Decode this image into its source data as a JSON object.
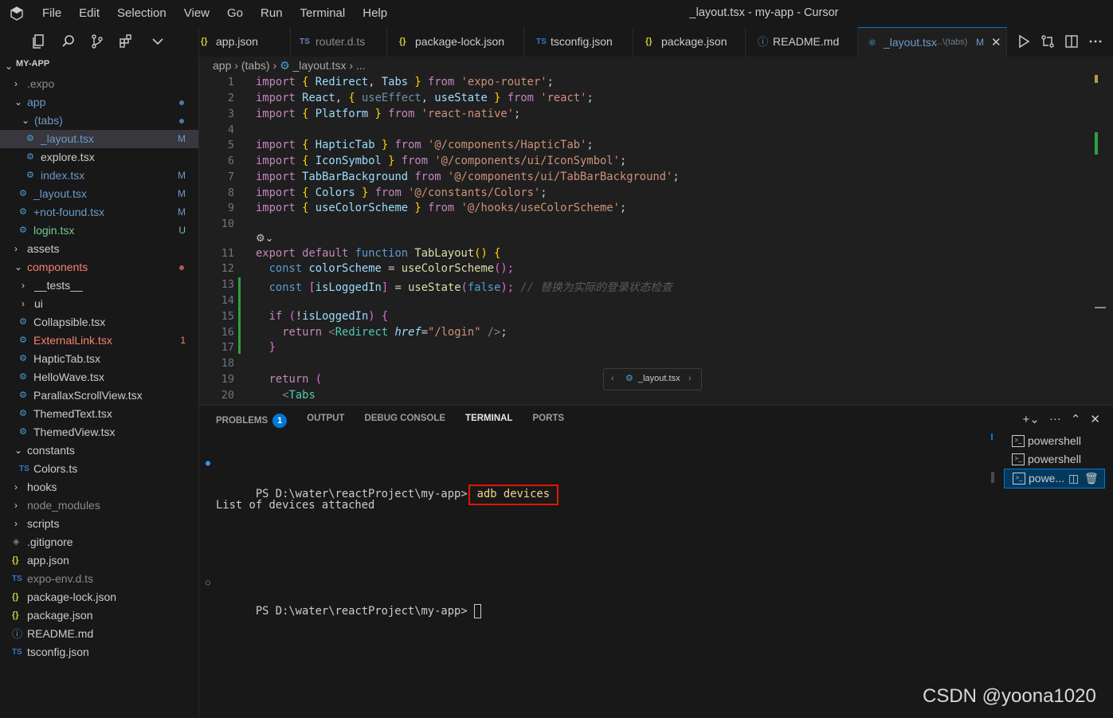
{
  "window": {
    "title": "_layout.tsx - my-app - Cursor"
  },
  "menu": [
    "File",
    "Edit",
    "Selection",
    "View",
    "Go",
    "Run",
    "Terminal",
    "Help"
  ],
  "sidebar": {
    "header": "MY-APP",
    "tree": [
      {
        "label": ".expo",
        "status": ""
      },
      {
        "label": "app",
        "status": ""
      },
      {
        "label": "(tabs)",
        "status": ""
      },
      {
        "label": "_layout.tsx",
        "status": "M"
      },
      {
        "label": "explore.tsx",
        "status": ""
      },
      {
        "label": "index.tsx",
        "status": "M"
      },
      {
        "label": "_layout.tsx",
        "status": "M"
      },
      {
        "label": "+not-found.tsx",
        "status": "M"
      },
      {
        "label": "login.tsx",
        "status": "U"
      },
      {
        "label": "assets",
        "status": ""
      },
      {
        "label": "components",
        "status": ""
      },
      {
        "label": "__tests__",
        "status": ""
      },
      {
        "label": "ui",
        "status": ""
      },
      {
        "label": "Collapsible.tsx",
        "status": ""
      },
      {
        "label": "ExternalLink.tsx",
        "status": "1"
      },
      {
        "label": "HapticTab.tsx",
        "status": ""
      },
      {
        "label": "HelloWave.tsx",
        "status": ""
      },
      {
        "label": "ParallaxScrollView.tsx",
        "status": ""
      },
      {
        "label": "ThemedText.tsx",
        "status": ""
      },
      {
        "label": "ThemedView.tsx",
        "status": ""
      },
      {
        "label": "constants",
        "status": ""
      },
      {
        "label": "Colors.ts",
        "status": ""
      },
      {
        "label": "hooks",
        "status": ""
      },
      {
        "label": "node_modules",
        "status": ""
      },
      {
        "label": "scripts",
        "status": ""
      },
      {
        "label": ".gitignore",
        "status": ""
      },
      {
        "label": "app.json",
        "status": ""
      },
      {
        "label": "expo-env.d.ts",
        "status": ""
      },
      {
        "label": "package-lock.json",
        "status": ""
      },
      {
        "label": "package.json",
        "status": ""
      },
      {
        "label": "README.md",
        "status": ""
      },
      {
        "label": "tsconfig.json",
        "status": ""
      }
    ]
  },
  "tabs": [
    {
      "label": "app.json",
      "icon": "{}"
    },
    {
      "label": "router.d.ts",
      "icon": "TS"
    },
    {
      "label": "package-lock.json",
      "icon": "{}"
    },
    {
      "label": "tsconfig.json",
      "icon": "TS"
    },
    {
      "label": "package.json",
      "icon": "{}"
    },
    {
      "label": "README.md",
      "icon": "ⓘ"
    },
    {
      "label": "_layout.tsx",
      "icon": "⚛",
      "path": "...\\(tabs)",
      "status": "M"
    }
  ],
  "breadcrumb": [
    "app",
    "(tabs)",
    "_layout.tsx",
    "..."
  ],
  "editor": {
    "line_numbers": [
      "1",
      "2",
      "3",
      "4",
      "5",
      "6",
      "7",
      "8",
      "9",
      "10",
      "11",
      "12",
      "13",
      "14",
      "15",
      "16",
      "17",
      "18",
      "19",
      "20"
    ],
    "code": {
      "l1": [
        "import",
        "{",
        "Redirect",
        ",",
        "Tabs",
        "}",
        "from",
        "'expo-router'",
        ";"
      ],
      "l2": [
        "import",
        "React",
        ",",
        "{",
        "useEffect",
        ",",
        "useState",
        "}",
        "from",
        "'react'",
        ";"
      ],
      "l3": [
        "import",
        "{",
        "Platform",
        "}",
        "from",
        "'react-native'",
        ";"
      ],
      "l5": [
        "import",
        "{",
        "HapticTab",
        "}",
        "from",
        "'@/components/HapticTab'",
        ";"
      ],
      "l6": [
        "import",
        "{",
        "IconSymbol",
        "}",
        "from",
        "'@/components/ui/IconSymbol'",
        ";"
      ],
      "l7": [
        "import",
        "TabBarBackground",
        "from",
        "'@/components/ui/TabBarBackground'",
        ";"
      ],
      "l8": [
        "import",
        "{",
        "Colors",
        "}",
        "from",
        "'@/constants/Colors'",
        ";"
      ],
      "l9": [
        "import",
        "{",
        "useColorScheme",
        "}",
        "from",
        "'@/hooks/useColorScheme'",
        ";"
      ],
      "l11": [
        "export",
        "default",
        "function",
        "TabLayout",
        "()",
        "{"
      ],
      "l12": [
        "const",
        "colorScheme",
        "=",
        "useColorScheme",
        "();"
      ],
      "l13": [
        "const",
        "[",
        "isLoggedIn",
        "]",
        "=",
        "useState",
        "(",
        "false",
        ");",
        "// 替换为实际的登录状态检查"
      ],
      "l15": [
        "if",
        "(",
        "!",
        "isLoggedIn",
        ")",
        "{"
      ],
      "l16": [
        "return",
        "<",
        "Redirect",
        "href",
        "=",
        "\"/login\"",
        "/>",
        ";"
      ],
      "l17": [
        "}"
      ],
      "l19": [
        "return",
        "("
      ],
      "l20": [
        "<",
        "Tabs"
      ]
    },
    "hover_hint": "_layout.tsx"
  },
  "panel": {
    "tabs": [
      "PROBLEMS",
      "OUTPUT",
      "DEBUG CONSOLE",
      "TERMINAL",
      "PORTS"
    ],
    "problems_count": "1",
    "terminal": {
      "prompt1": "PS D:\\water\\reactProject\\my-app>",
      "command": "adb devices",
      "output": "List of devices attached",
      "prompt2": "PS D:\\water\\reactProject\\my-app>"
    },
    "terminal_list": [
      "powershell",
      "powershell",
      "powe..."
    ]
  },
  "watermark": "CSDN @yoona1020",
  "colors": {
    "accent": "#0078d4",
    "highlight_box": "#e51400",
    "modified": "#6c9ac8",
    "untracked": "#73c991",
    "error": "#f88070"
  }
}
